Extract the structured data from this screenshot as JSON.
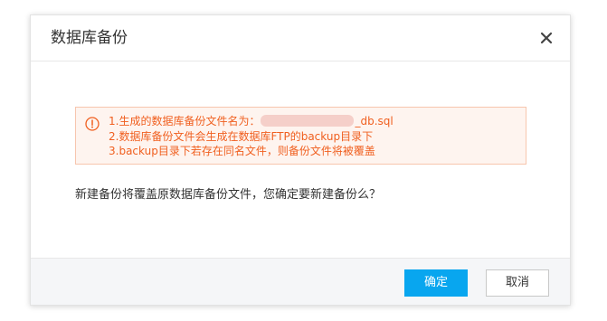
{
  "dialog": {
    "title": "数据库备份",
    "close_icon": "close-icon"
  },
  "alert": {
    "icon": "warning-circle-icon",
    "line1_prefix": "1.生成的数据库备份文件名为：",
    "line1_suffix": "_db.sql",
    "line2": "2.数据库备份文件会生成在数据库FTP的backup目录下",
    "line3": "3.backup目录下若存在同名文件，则备份文件将被覆盖",
    "color": "#f05f1f",
    "background": "#fef4ef"
  },
  "question": "新建备份将覆盖原数据库备份文件，您确定要新建备份么？",
  "footer": {
    "confirm_label": "确定",
    "cancel_label": "取消",
    "confirm_color": "#08a6ef"
  }
}
